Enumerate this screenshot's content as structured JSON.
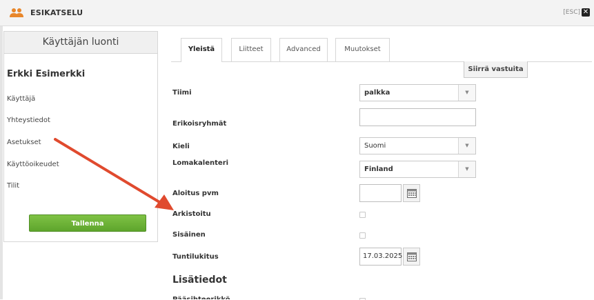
{
  "window": {
    "title": "ESIKATSELU",
    "esc_label": "[ESC]",
    "close_symbol": "✕"
  },
  "sidebar": {
    "header": "Käyttäjän luonti",
    "user_name": "Erkki Esimerkki",
    "items": [
      {
        "label": "Käyttäjä"
      },
      {
        "label": "Yhteystiedot"
      },
      {
        "label": "Asetukset"
      },
      {
        "label": "Käyttöoikeudet"
      },
      {
        "label": "Tilit"
      }
    ],
    "save_label": "Tallenna"
  },
  "tabs": [
    {
      "label": "Yleistä",
      "active": true
    },
    {
      "label": "Liitteet",
      "active": false
    },
    {
      "label": "Advanced",
      "active": false
    },
    {
      "label": "Muutokset",
      "active": false
    }
  ],
  "actions": {
    "transfer_label": "Siirrä vastuita"
  },
  "form": {
    "team": {
      "label": "Tiimi",
      "value": "palkka"
    },
    "special_groups": {
      "label": "Erikoisryhmät",
      "value": ""
    },
    "language": {
      "label": "Kieli",
      "value": "Suomi"
    },
    "holiday_calendar": {
      "label": "Lomakalenteri",
      "value": "Finland"
    },
    "start_date": {
      "label": "Aloitus pvm",
      "value": ""
    },
    "archived": {
      "label": "Arkistoitu",
      "checked": false
    },
    "internal": {
      "label": "Sisäinen",
      "checked": false
    },
    "hour_lock": {
      "label": "Tuntilukitus",
      "value": "17.03.2025"
    },
    "section_title": "Lisätiedot",
    "next_label": "Pääsihteerikkö"
  },
  "icons": {
    "window": "users-icon",
    "close": "close-icon",
    "dropdown": "chevron-down-icon",
    "calendar": "calendar-icon"
  },
  "colors": {
    "accent_orange": "#e8862a",
    "save_green": "#6bb336",
    "annotation_arrow": "#e04a2e"
  }
}
